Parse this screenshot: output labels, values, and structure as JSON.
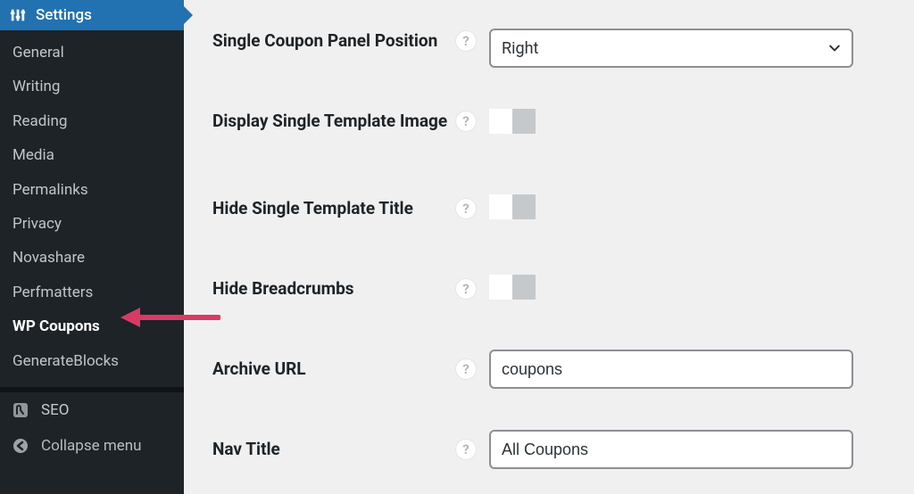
{
  "sidebar": {
    "header_label": "Settings",
    "items": [
      {
        "label": "General",
        "current": false
      },
      {
        "label": "Writing",
        "current": false
      },
      {
        "label": "Reading",
        "current": false
      },
      {
        "label": "Media",
        "current": false
      },
      {
        "label": "Permalinks",
        "current": false
      },
      {
        "label": "Privacy",
        "current": false
      },
      {
        "label": "Novashare",
        "current": false
      },
      {
        "label": "Perfmatters",
        "current": false
      },
      {
        "label": "WP Coupons",
        "current": true
      },
      {
        "label": "GenerateBlocks",
        "current": false
      }
    ],
    "seo_label": "SEO",
    "collapse_label": "Collapse menu"
  },
  "settings": {
    "panel_position": {
      "label": "Single Coupon Panel Position",
      "value": "Right"
    },
    "single_image": {
      "label": "Display Single Template Image",
      "value": false
    },
    "hide_title": {
      "label": "Hide Single Template Title",
      "value": false
    },
    "hide_breadcrumbs": {
      "label": "Hide Breadcrumbs",
      "value": false
    },
    "archive_url": {
      "label": "Archive URL",
      "value": "coupons"
    },
    "nav_title": {
      "label": "Nav Title",
      "value": "All Coupons"
    }
  },
  "glyphs": {
    "help": "?"
  },
  "colors": {
    "accent": "#2271b1",
    "arrow": "#d93a63"
  }
}
